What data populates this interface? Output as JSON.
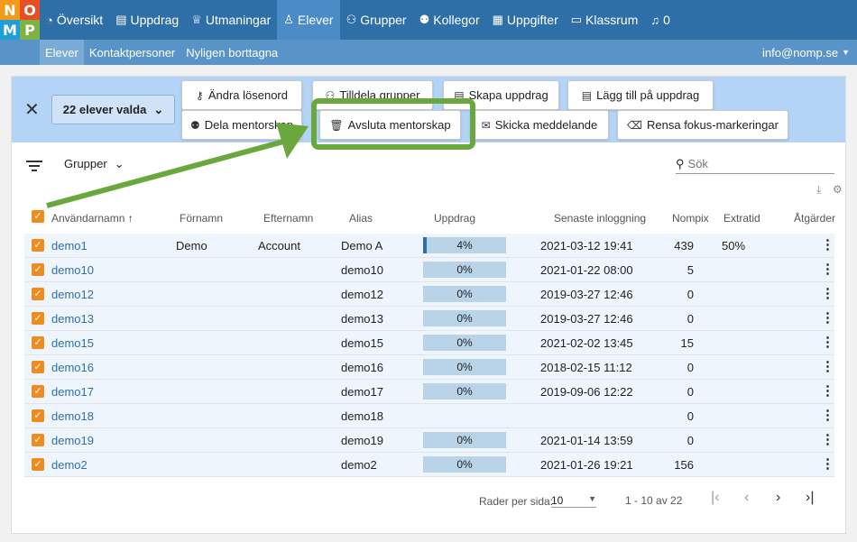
{
  "logo": [
    "N",
    "O",
    "M",
    "P"
  ],
  "nav": [
    {
      "label": "Översikt",
      "icon": "dashboard-icon",
      "glyph": "◔"
    },
    {
      "label": "Uppdrag",
      "icon": "assignment-icon",
      "glyph": "▤"
    },
    {
      "label": "Utmaningar",
      "icon": "trophy-icon",
      "glyph": "♕"
    },
    {
      "label": "Elever",
      "icon": "user-icon",
      "glyph": "♙"
    },
    {
      "label": "Grupper",
      "icon": "groups-icon",
      "glyph": "⚇"
    },
    {
      "label": "Kollegor",
      "icon": "colleagues-icon",
      "glyph": "⚉"
    },
    {
      "label": "Uppgifter",
      "icon": "grid-icon",
      "glyph": "▦"
    },
    {
      "label": "Klassrum",
      "icon": "classroom-icon",
      "glyph": "▭"
    },
    {
      "label": "0",
      "icon": "bell-icon",
      "glyph": "♫"
    }
  ],
  "subnav": [
    "Elever",
    "Kontaktpersoner",
    "Nyligen borttagna"
  ],
  "user_email": "info@nomp.se",
  "selection": {
    "count_label": "22 elever valda"
  },
  "actions": {
    "change_password": "Ändra lösenord",
    "assign_groups": "Tilldela grupper",
    "create_assignment": "Skapa uppdrag",
    "add_to_assignment": "Lägg till på uppdrag",
    "share_mentorship": "Dela mentorskap",
    "end_mentorship": "Avsluta mentorskap",
    "send_message": "Skicka meddelande",
    "clear_focus": "Rensa fokus-markeringar"
  },
  "toolbar": {
    "groups_label": "Grupper",
    "search_placeholder": "Sök"
  },
  "columns": {
    "username": "Användarnamn",
    "first_name": "Förnamn",
    "last_name": "Efternamn",
    "alias": "Alias",
    "assignments": "Uppdrag",
    "last_login": "Senaste inloggning",
    "nompix": "Nompix",
    "extra_time": "Extratid",
    "actions": "Åtgärder"
  },
  "rows": [
    {
      "username": "demo1",
      "first": "Demo",
      "last": "Account",
      "alias": "Demo A",
      "progress": 4,
      "progress_label": "4%",
      "login": "2021-03-12 19:41",
      "nompix": "439",
      "extra": "50%"
    },
    {
      "username": "demo10",
      "first": "",
      "last": "",
      "alias": "demo10",
      "progress": 0,
      "progress_label": "0%",
      "login": "2021-01-22 08:00",
      "nompix": "5",
      "extra": ""
    },
    {
      "username": "demo12",
      "first": "",
      "last": "",
      "alias": "demo12",
      "progress": 0,
      "progress_label": "0%",
      "login": "2019-03-27 12:46",
      "nompix": "0",
      "extra": ""
    },
    {
      "username": "demo13",
      "first": "",
      "last": "",
      "alias": "demo13",
      "progress": 0,
      "progress_label": "0%",
      "login": "2019-03-27 12:46",
      "nompix": "0",
      "extra": ""
    },
    {
      "username": "demo15",
      "first": "",
      "last": "",
      "alias": "demo15",
      "progress": 0,
      "progress_label": "0%",
      "login": "2021-02-02 13:45",
      "nompix": "15",
      "extra": ""
    },
    {
      "username": "demo16",
      "first": "",
      "last": "",
      "alias": "demo16",
      "progress": 0,
      "progress_label": "0%",
      "login": "2018-02-15 11:12",
      "nompix": "0",
      "extra": ""
    },
    {
      "username": "demo17",
      "first": "",
      "last": "",
      "alias": "demo17",
      "progress": 0,
      "progress_label": "0%",
      "login": "2019-09-06 12:22",
      "nompix": "0",
      "extra": ""
    },
    {
      "username": "demo18",
      "first": "",
      "last": "",
      "alias": "demo18",
      "progress": null,
      "progress_label": "",
      "login": "",
      "nompix": "0",
      "extra": ""
    },
    {
      "username": "demo19",
      "first": "",
      "last": "",
      "alias": "demo19",
      "progress": 0,
      "progress_label": "0%",
      "login": "2021-01-14 13:59",
      "nompix": "0",
      "extra": ""
    },
    {
      "username": "demo2",
      "first": "",
      "last": "",
      "alias": "demo2",
      "progress": 0,
      "progress_label": "0%",
      "login": "2021-01-26 19:21",
      "nompix": "156",
      "extra": ""
    }
  ],
  "pagination": {
    "rows_per_page_label": "Rader per sida:",
    "rows_per_page": "10",
    "range": "1 - 10 av 22"
  },
  "colors": {
    "primary": "#2f6fa7",
    "selection_bar": "#b3d4f7",
    "highlight": "#6aa83e",
    "checkbox": "#f08c1e"
  }
}
